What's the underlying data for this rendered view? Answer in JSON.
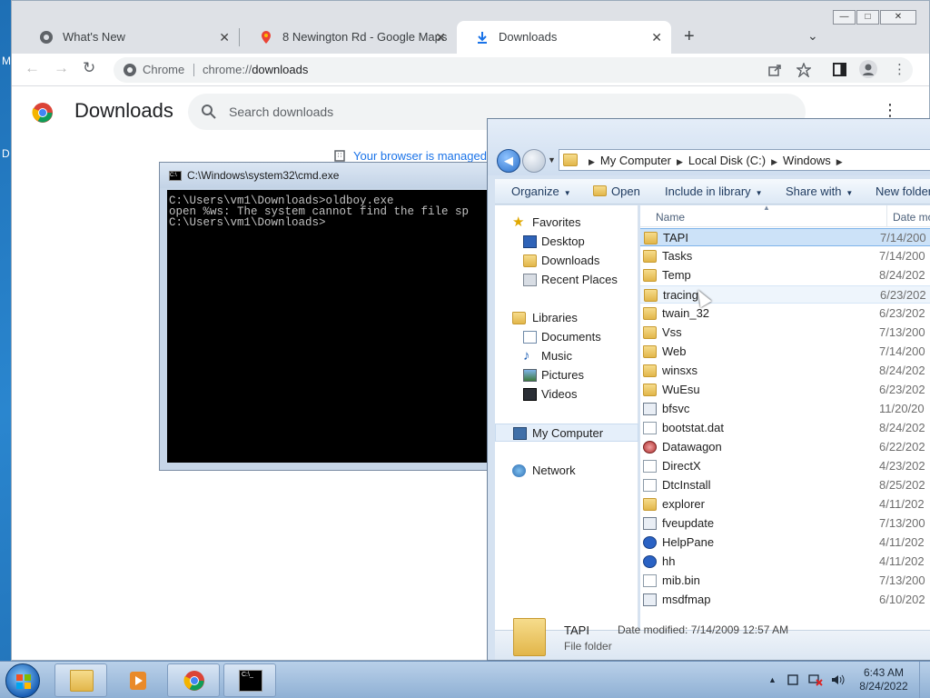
{
  "chrome": {
    "tabs": [
      {
        "title": "What's New",
        "close": "✕"
      },
      {
        "title": "8 Newington Rd - Google Maps",
        "close": "✕"
      },
      {
        "title": "Downloads",
        "close": "✕"
      }
    ],
    "new_tab": "+",
    "tab_search": "⌄",
    "window_buttons": {
      "minimize": "—",
      "maximize": "□",
      "close": "✕"
    },
    "nav": {
      "back": "←",
      "forward": "→",
      "reload": "↻"
    },
    "omnibox": {
      "origin_label": "Chrome",
      "url_scheme": "chrome://",
      "url_path": "downloads"
    },
    "page": {
      "title": "Downloads",
      "search_placeholder": "Search downloads",
      "menu": "⋮",
      "managed_notice": "Your browser is managed"
    }
  },
  "cmd": {
    "title": "C:\\Windows\\system32\\cmd.exe",
    "lines": [
      "C:\\Users\\vm1\\Downloads>oldboy.exe",
      "open %ws: The system cannot find the file sp",
      "C:\\Users\\vm1\\Downloads>"
    ]
  },
  "explorer": {
    "breadcrumb": [
      "My Computer",
      "Local Disk (C:)",
      "Windows"
    ],
    "commands": [
      "Organize",
      "Open",
      "Include in library",
      "Share with",
      "New folder"
    ],
    "nav_pane": {
      "favorites_header": "Favorites",
      "favorites": [
        "Desktop",
        "Downloads",
        "Recent Places"
      ],
      "libraries_header": "Libraries",
      "libraries": [
        "Documents",
        "Music",
        "Pictures",
        "Videos"
      ],
      "computer": "My Computer",
      "network": "Network"
    },
    "columns": {
      "name": "Name",
      "date": "Date mo"
    },
    "files": [
      {
        "name": "TAPI",
        "date": "7/14/200",
        "icon": "folder-icon"
      },
      {
        "name": "Tasks",
        "date": "7/14/200",
        "icon": "folder-icon"
      },
      {
        "name": "Temp",
        "date": "8/24/202",
        "icon": "folder-icon"
      },
      {
        "name": "tracing",
        "date": "6/23/202",
        "icon": "folder-icon"
      },
      {
        "name": "twain_32",
        "date": "6/23/202",
        "icon": "folder-icon"
      },
      {
        "name": "Vss",
        "date": "7/13/200",
        "icon": "folder-icon"
      },
      {
        "name": "Web",
        "date": "7/14/200",
        "icon": "folder-icon"
      },
      {
        "name": "winsxs",
        "date": "8/24/202",
        "icon": "folder-icon"
      },
      {
        "name": "WuEsu",
        "date": "6/23/202",
        "icon": "folder-icon"
      },
      {
        "name": "bfsvc",
        "date": "11/20/20",
        "icon": "executable-icon"
      },
      {
        "name": "bootstat.dat",
        "date": "8/24/202",
        "icon": "file-icon"
      },
      {
        "name": "Datawagon",
        "date": "6/22/202",
        "icon": "gear-icon"
      },
      {
        "name": "DirectX",
        "date": "4/23/202",
        "icon": "file-icon"
      },
      {
        "name": "DtcInstall",
        "date": "8/25/202",
        "icon": "file-icon"
      },
      {
        "name": "explorer",
        "date": "4/11/202",
        "icon": "explorer-icon"
      },
      {
        "name": "fveupdate",
        "date": "7/13/200",
        "icon": "executable-icon"
      },
      {
        "name": "HelpPane",
        "date": "4/11/202",
        "icon": "help-icon"
      },
      {
        "name": "hh",
        "date": "4/11/202",
        "icon": "help-book-icon"
      },
      {
        "name": "mib.bin",
        "date": "7/13/200",
        "icon": "file-icon"
      },
      {
        "name": "msdfmap",
        "date": "6/10/202",
        "icon": "settings-file-icon"
      }
    ],
    "details": {
      "name": "TAPI",
      "modified_label": "Date modified:",
      "modified_value": "7/14/2009 12:57 AM",
      "type": "File folder"
    }
  },
  "taskbar": {
    "clock_time": "6:43 AM",
    "clock_date": "8/24/2022",
    "tray_chevron": "▲"
  },
  "desktop": {
    "edge_labels": [
      "M",
      "D"
    ]
  },
  "colors": {
    "chrome_tabstrip": "#dee1e6",
    "explorer_frame": "#d5e2f1",
    "selection": "#cce2f8",
    "taskbar": "#a9c3e0"
  }
}
